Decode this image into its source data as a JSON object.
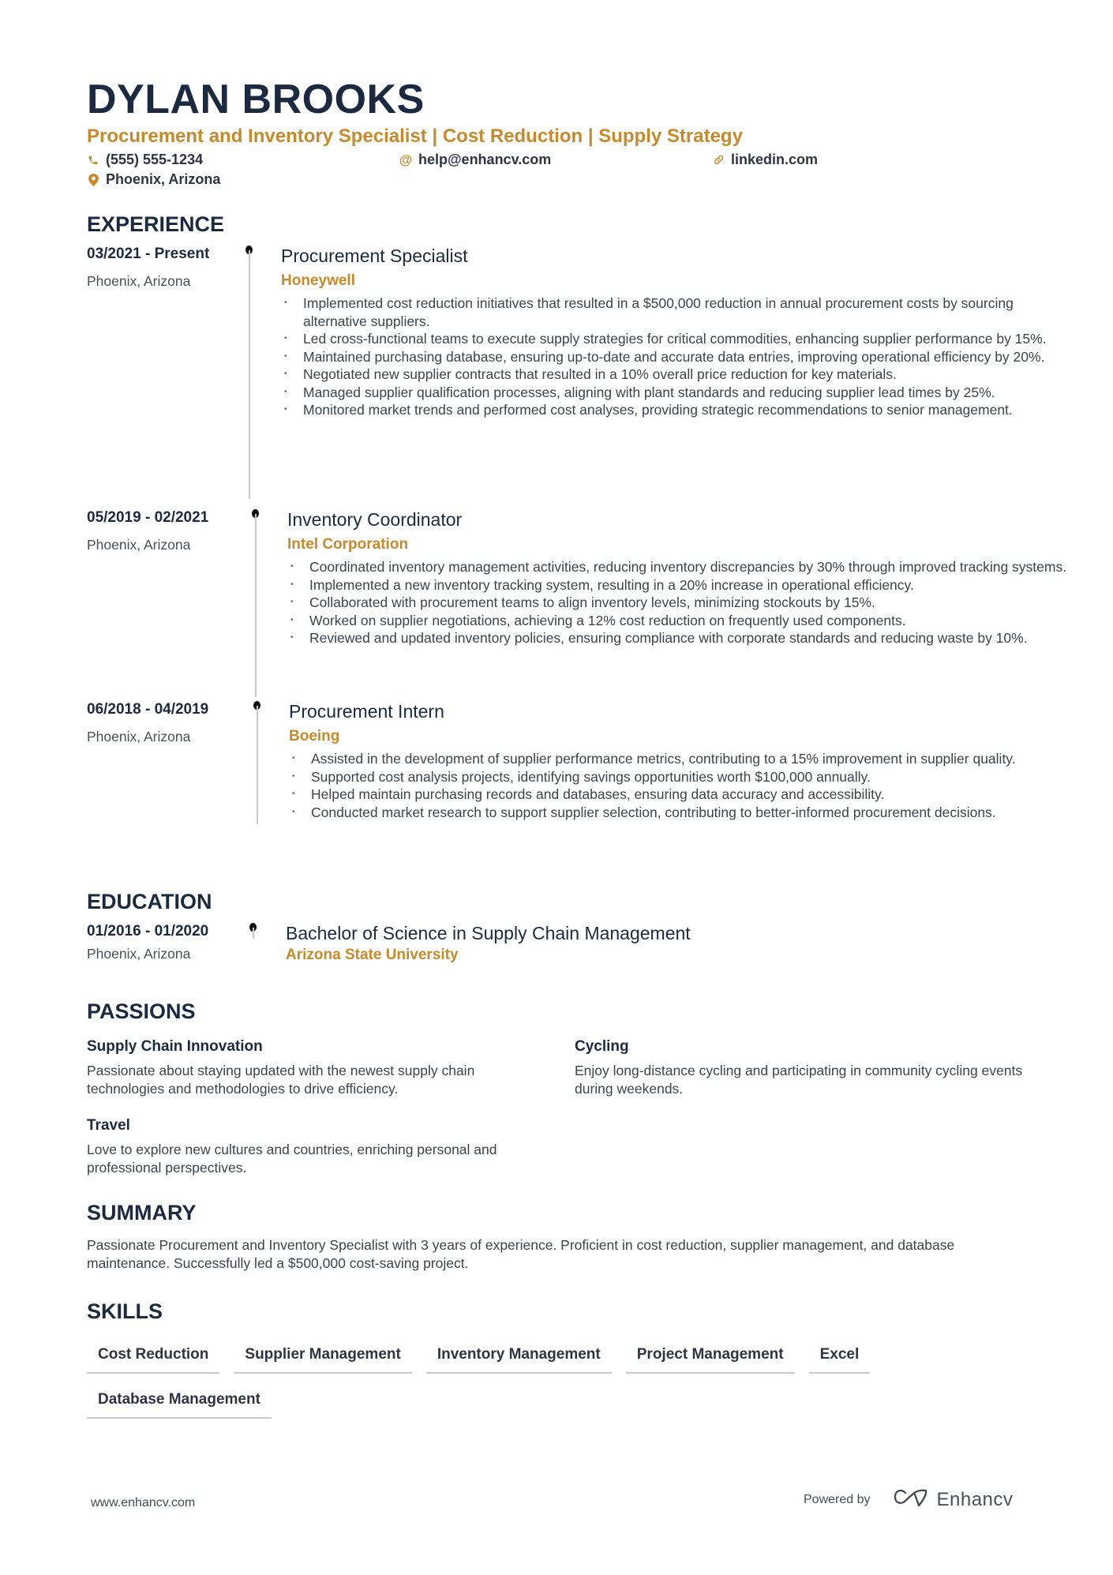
{
  "header": {
    "name": "DYLAN BROOKS",
    "title": "Procurement and Inventory Specialist | Cost Reduction | Supply Strategy",
    "phone": "(555) 555-1234",
    "email": "help@enhancv.com",
    "link": "linkedin.com",
    "location": "Phoenix, Arizona",
    "icons": {
      "phone": "phone-icon",
      "email": "at-icon",
      "link": "link-icon",
      "location": "map-pin-icon"
    }
  },
  "colors": {
    "accent": "#c8892a",
    "heading": "#1b2a41",
    "text": "#3d424b",
    "rule": "#c9c9c9"
  },
  "experience": {
    "heading": "EXPERIENCE",
    "items": [
      {
        "date": "03/2021 - Present",
        "location": "Phoenix, Arizona",
        "role": "Procurement Specialist",
        "company": "Honeywell",
        "bullets": [
          "Implemented cost reduction initiatives that resulted in a $500,000 reduction in annual procurement costs by sourcing alternative suppliers.",
          "Led cross-functional teams to execute supply strategies for critical commodities, enhancing supplier performance by 15%.",
          "Maintained purchasing database, ensuring up-to-date and accurate data entries, improving operational efficiency by 20%.",
          "Negotiated new supplier contracts that resulted in a 10% overall price reduction for key materials.",
          "Managed supplier qualification processes, aligning with plant standards and reducing supplier lead times by 25%.",
          "Monitored market trends and performed cost analyses, providing strategic recommendations to senior management."
        ]
      },
      {
        "date": "05/2019 - 02/2021",
        "location": "Phoenix, Arizona",
        "role": "Inventory Coordinator",
        "company": "Intel Corporation",
        "bullets": [
          "Coordinated inventory management activities, reducing inventory discrepancies by 30% through improved tracking systems.",
          "Implemented a new inventory tracking system, resulting in a 20% increase in operational efficiency.",
          "Collaborated with procurement teams to align inventory levels, minimizing stockouts by 15%.",
          "Worked on supplier negotiations, achieving a 12% cost reduction on frequently used components.",
          "Reviewed and updated inventory policies, ensuring compliance with corporate standards and reducing waste by 10%."
        ]
      },
      {
        "date": "06/2018 - 04/2019",
        "location": "Phoenix, Arizona",
        "role": "Procurement Intern",
        "company": "Boeing",
        "bullets": [
          "Assisted in the development of supplier performance metrics, contributing to a 15% improvement in supplier quality.",
          "Supported cost analysis projects, identifying savings opportunities worth $100,000 annually.",
          "Helped maintain purchasing records and databases, ensuring data accuracy and accessibility.",
          "Conducted market research to support supplier selection, contributing to better-informed procurement decisions."
        ]
      }
    ]
  },
  "education": {
    "heading": "EDUCATION",
    "items": [
      {
        "date": "01/2016 - 01/2020",
        "location": "Phoenix, Arizona",
        "degree": "Bachelor of Science in Supply Chain Management",
        "school": "Arizona State University"
      }
    ]
  },
  "passions": {
    "heading": "PASSIONS",
    "items": [
      {
        "title": "Supply Chain Innovation",
        "description": "Passionate about staying updated with the newest supply chain technologies and methodologies to drive efficiency."
      },
      {
        "title": "Cycling",
        "description": "Enjoy long-distance cycling and participating in community cycling events during weekends."
      },
      {
        "title": "Travel",
        "description": "Love to explore new cultures and countries, enriching personal and professional perspectives."
      }
    ]
  },
  "summary": {
    "heading": "SUMMARY",
    "text": "Passionate Procurement and Inventory Specialist with 3 years of experience. Proficient in cost reduction, supplier management, and database maintenance. Successfully led a $500,000 cost-saving project."
  },
  "skills": {
    "heading": "SKILLS",
    "items": [
      "Cost Reduction",
      "Supplier Management",
      "Inventory Management",
      "Project Management",
      "Excel",
      "Database Management"
    ]
  },
  "footer": {
    "website": "www.enhancv.com",
    "powered_by": "Powered by",
    "brand": "Enhancv",
    "brand_icon": "enhancv-logo-icon"
  }
}
